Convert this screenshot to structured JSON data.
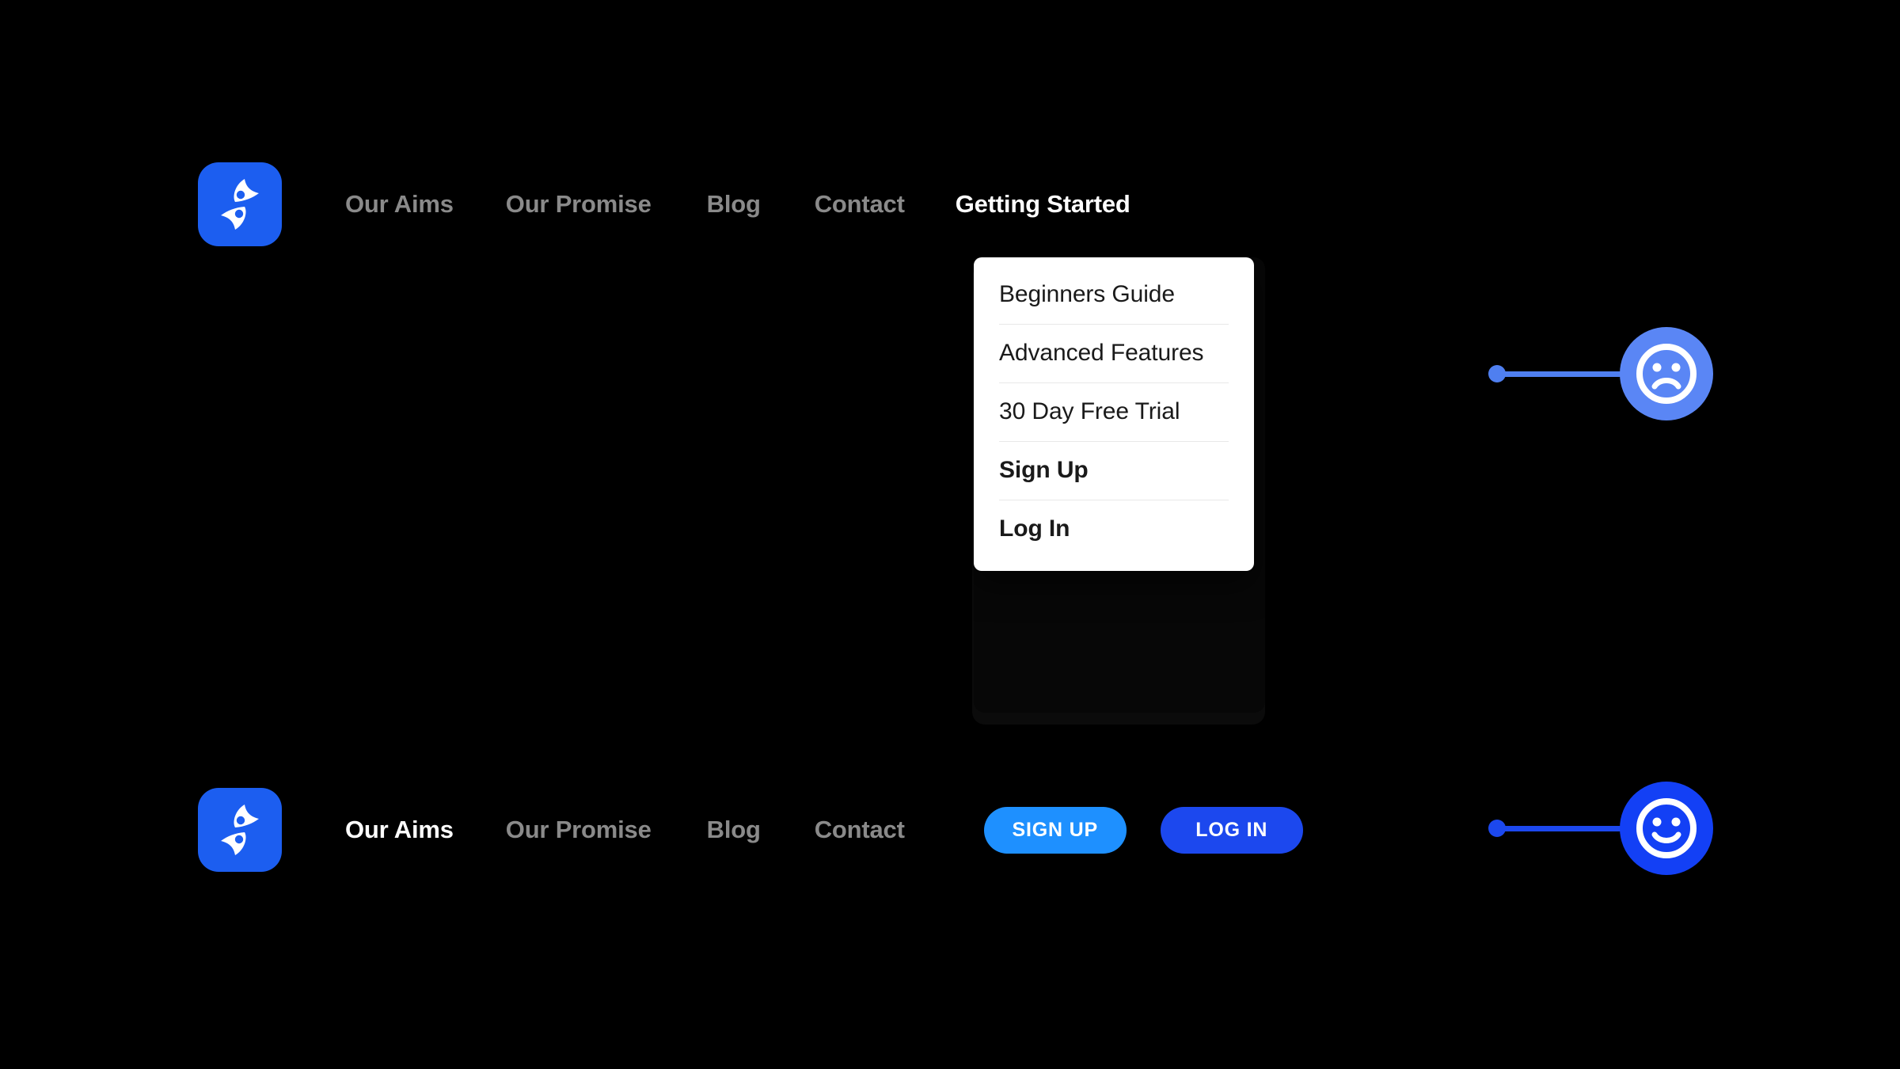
{
  "background_color": "#000000",
  "brand": {
    "logo_icon": "flame-leaf-logo-icon",
    "logo_bg_color": "#1c5ef0",
    "logo_mark_color": "#ffffff"
  },
  "top_nav": {
    "items": [
      {
        "label": "Our Aims",
        "active": false
      },
      {
        "label": "Our Promise",
        "active": false
      },
      {
        "label": "Blog",
        "active": false
      },
      {
        "label": "Contact",
        "active": false
      },
      {
        "label": "Getting Started",
        "active": true
      }
    ],
    "inactive_color": "#8a8a8a",
    "active_color": "#ffffff"
  },
  "dropdown": {
    "open": true,
    "owner": "Getting Started",
    "background_color": "#ffffff",
    "divider_color": "#e8e8e8",
    "items": [
      {
        "label": "Beginners Guide",
        "bold": false
      },
      {
        "label": "Advanced Features",
        "bold": false
      },
      {
        "label": "30 Day Free Trial",
        "bold": false
      },
      {
        "label": "Sign Up",
        "bold": true
      },
      {
        "label": "Log In",
        "bold": true
      }
    ]
  },
  "bottom_nav": {
    "items": [
      {
        "label": "Our Aims",
        "active": true
      },
      {
        "label": "Our Promise",
        "active": false
      },
      {
        "label": "Blog",
        "active": false
      },
      {
        "label": "Contact",
        "active": false
      }
    ],
    "buttons": [
      {
        "label": "SIGN UP",
        "color": "#1e90ff"
      },
      {
        "label": "LOG IN",
        "color": "#1c48ee"
      }
    ]
  },
  "mood_sliders": [
    {
      "state": "sad",
      "face_icon": "sad-face-icon",
      "handle_position": "left",
      "accent_color": "#5a86f5"
    },
    {
      "state": "happy",
      "face_icon": "happy-face-icon",
      "handle_position": "left",
      "accent_color": "#1340f5"
    }
  ]
}
